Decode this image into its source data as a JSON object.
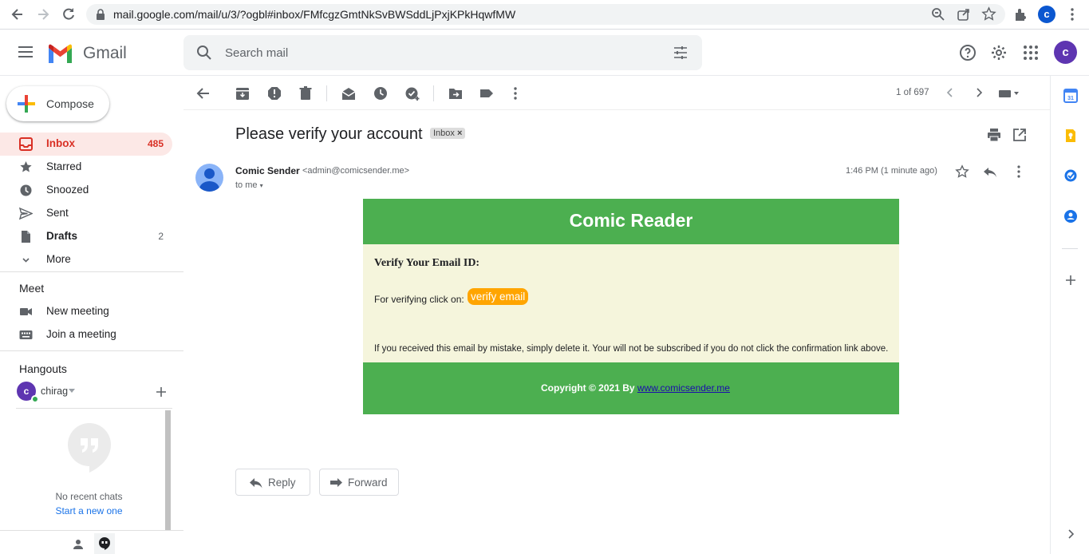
{
  "browser": {
    "url": "mail.google.com/mail/u/3/?ogbl#inbox/FMfcgzGmtNkSvBWSddLjPxjKPkHqwfMW",
    "profile_initial": "c"
  },
  "header": {
    "app_name": "Gmail",
    "search_placeholder": "Search mail",
    "avatar_initial": "c"
  },
  "sidebar": {
    "compose_label": "Compose",
    "items": [
      {
        "label": "Inbox",
        "count": "485"
      },
      {
        "label": "Starred",
        "count": ""
      },
      {
        "label": "Snoozed",
        "count": ""
      },
      {
        "label": "Sent",
        "count": ""
      },
      {
        "label": "Drafts",
        "count": "2"
      },
      {
        "label": "More",
        "count": ""
      }
    ],
    "meet": {
      "title": "Meet",
      "new_meeting": "New meeting",
      "join_meeting": "Join a meeting"
    },
    "hangouts": {
      "title": "Hangouts",
      "user": "chirag",
      "user_initial": "c",
      "no_chats": "No recent chats",
      "start_new": "Start a new one"
    }
  },
  "toolbar": {
    "pagination": "1 of 697"
  },
  "message": {
    "subject": "Please verify your account",
    "label_chip": "Inbox",
    "sender_name": "Comic Sender",
    "sender_email": "<admin@comicsender.me>",
    "recipient": "to me",
    "time": "1:46 PM (1 minute ago)",
    "body": {
      "brand": "Comic Reader",
      "heading": "Verify Your Email ID:",
      "prompt": "For verifying click on:",
      "button": "verify email",
      "disclaimer": "If you received this email by mistake, simply delete it. Your will not be subscribed if you do not click the confirmation link above.",
      "copyright": "Copyright © 2021 By",
      "site_link": "www.comicsender.me"
    }
  },
  "actions": {
    "reply": "Reply",
    "forward": "Forward"
  },
  "colors": {
    "brand_green": "#4caf50",
    "verify_orange": "#ffa500",
    "inbox_red": "#d93025",
    "card_bg": "#f5f5dc"
  }
}
